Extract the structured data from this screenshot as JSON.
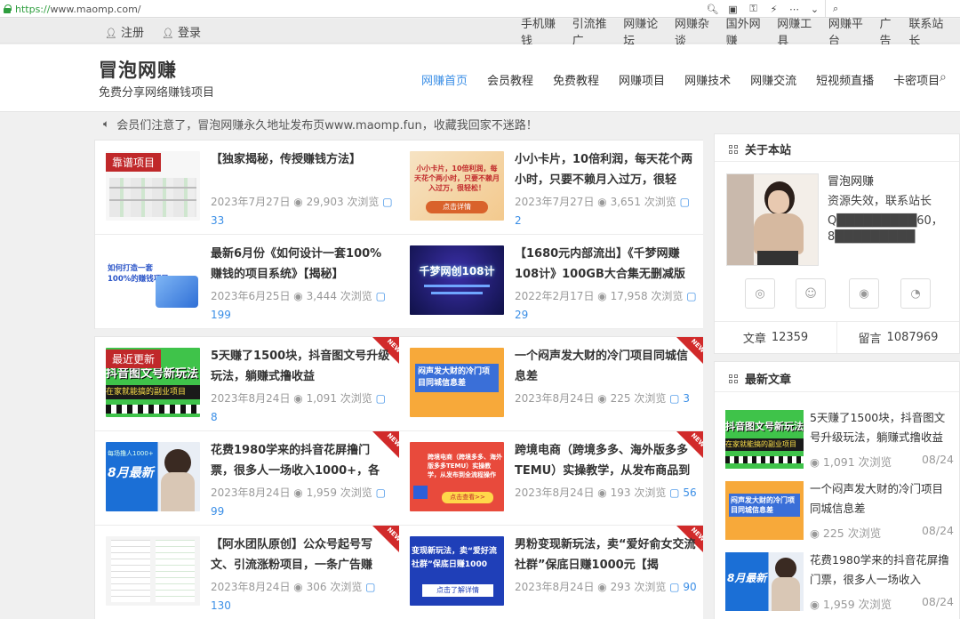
{
  "browser": {
    "protocol": "https://",
    "url": "www.maomp.com/"
  },
  "topbar": {
    "left": [
      {
        "icon": "user-icon",
        "label": "注册"
      },
      {
        "icon": "user-filled-icon",
        "label": "登录"
      }
    ],
    "right": [
      "手机赚钱",
      "引流推广",
      "网赚论坛",
      "网赚杂谈",
      "国外网赚",
      "网赚工具",
      "网赚平台",
      "广告",
      "联系站长"
    ]
  },
  "site": {
    "name": "冒泡网赚",
    "tagline": "免费分享网络赚钱项目"
  },
  "nav": [
    "网赚首页",
    "会员教程",
    "免费教程",
    "网赚项目",
    "网赚技术",
    "网赚交流",
    "短视频直播",
    "卡密项目"
  ],
  "notice": "会员们注意了，冒泡网赚永久地址发布页www.maomp.fun，收藏我回家不迷路！",
  "featured": {
    "ribbon": "靠谱项目",
    "posts": [
      {
        "title": "【独家揭秘，传授赚钱方法】",
        "date": "2023年7月27日",
        "views": "29,903 次浏览",
        "comments": "33"
      },
      {
        "title": "小小卡片，10倍利润，每天花个两小时，只要不赖月入过万，很轻",
        "date": "2023年7月27日",
        "views": "3,651 次浏览",
        "comments": "2"
      },
      {
        "title": "最新6月份《如何设计一套100%赚钱的项目系统》【揭秘】",
        "date": "2023年6月25日",
        "views": "3,444 次浏览",
        "comments": "199"
      },
      {
        "title": "【1680元内部流出】《千梦网赚108计》100GB大合集无删减版",
        "date": "2022年2月17日",
        "views": "17,958 次浏览",
        "comments": "29"
      }
    ]
  },
  "latest": {
    "ribbon": "最近更新",
    "new_label": "NEW",
    "posts": [
      {
        "title": "5天赚了1500块，抖音图文号升级玩法，躺赚式撸收益",
        "date": "2023年8月24日",
        "views": "1,091 次浏览",
        "comments": "8"
      },
      {
        "title": "一个闷声发大财的冷门项目同城信息差",
        "date": "2023年8月24日",
        "views": "225 次浏览",
        "comments": "3"
      },
      {
        "title": "花费1980学来的抖音花屏撸门票，很多人一场收入1000+，各",
        "date": "2023年8月24日",
        "views": "1,959 次浏览",
        "comments": "99"
      },
      {
        "title": "跨境电商（跨境多多、海外版多多TEMU）实操教学，从发布商品到",
        "date": "2023年8月24日",
        "views": "193 次浏览",
        "comments": "56"
      },
      {
        "title": "【阿水团队原创】公众号起号写文、引流涨粉项目，一条广告赚",
        "date": "2023年8月24日",
        "views": "306 次浏览",
        "comments": "130"
      },
      {
        "title": "男粉变现新玩法，卖“爱好俞女交流社群”保底日赚1000元【揭",
        "date": "2023年8月24日",
        "views": "293 次浏览",
        "comments": "90"
      }
    ]
  },
  "thumb_texts": {
    "card_offer": "小小卡片，10倍利润，每天花个两小时，只要不赖月入过万，很轻松！",
    "card_offer_btn": "点击详情",
    "design": "如何打造一套100%的赚钱项目",
    "qianmeng": "千梦网创108计",
    "tuwen": "抖音图文号新玩法",
    "tuwen_sub": "在家就能搞的副业项目",
    "lengmen": "闷声发大财的冷门项目同城信息差",
    "huaping": "8月最新",
    "huaping_sub": "每场撸人1000+",
    "temu": "跨境电商（跨境多多、海外版多多TEMU）实操教学，从发布到全流程操作",
    "temu_btn": "点击查看>>",
    "nanfen": "变现新玩法，卖“爱好流社群”保底日赚1000",
    "nanfen_btn": "点击了解详情"
  },
  "about": {
    "title": "关于本站",
    "name": "冒泡网赚",
    "desc": "资源失效，联系站长",
    "contact1": "Q█████████60，",
    "contact2": "8█████████",
    "social": [
      "wechat-icon",
      "qq-icon",
      "weibo-icon",
      "rss-icon"
    ],
    "stats": [
      {
        "label": "文章",
        "value": "12359"
      },
      {
        "label": "留言",
        "value": "1087969"
      }
    ]
  },
  "recent": {
    "title": "最新文章",
    "posts": [
      {
        "title": "5天赚了1500块，抖音图文号升级玩法，躺赚式撸收益",
        "views": "1,091 次浏览",
        "date": "08/24"
      },
      {
        "title": "一个闷声发大财的冷门项目同城信息差",
        "views": "225 次浏览",
        "date": "08/24"
      },
      {
        "title": "花费1980学来的抖音花屏撸门票，很多人一场收入",
        "views": "1,959 次浏览",
        "date": "08/24"
      }
    ]
  },
  "colors": {
    "accent": "#3a8ee6",
    "ribbon": "#c0282a",
    "new_tag": "#d12a2a"
  }
}
